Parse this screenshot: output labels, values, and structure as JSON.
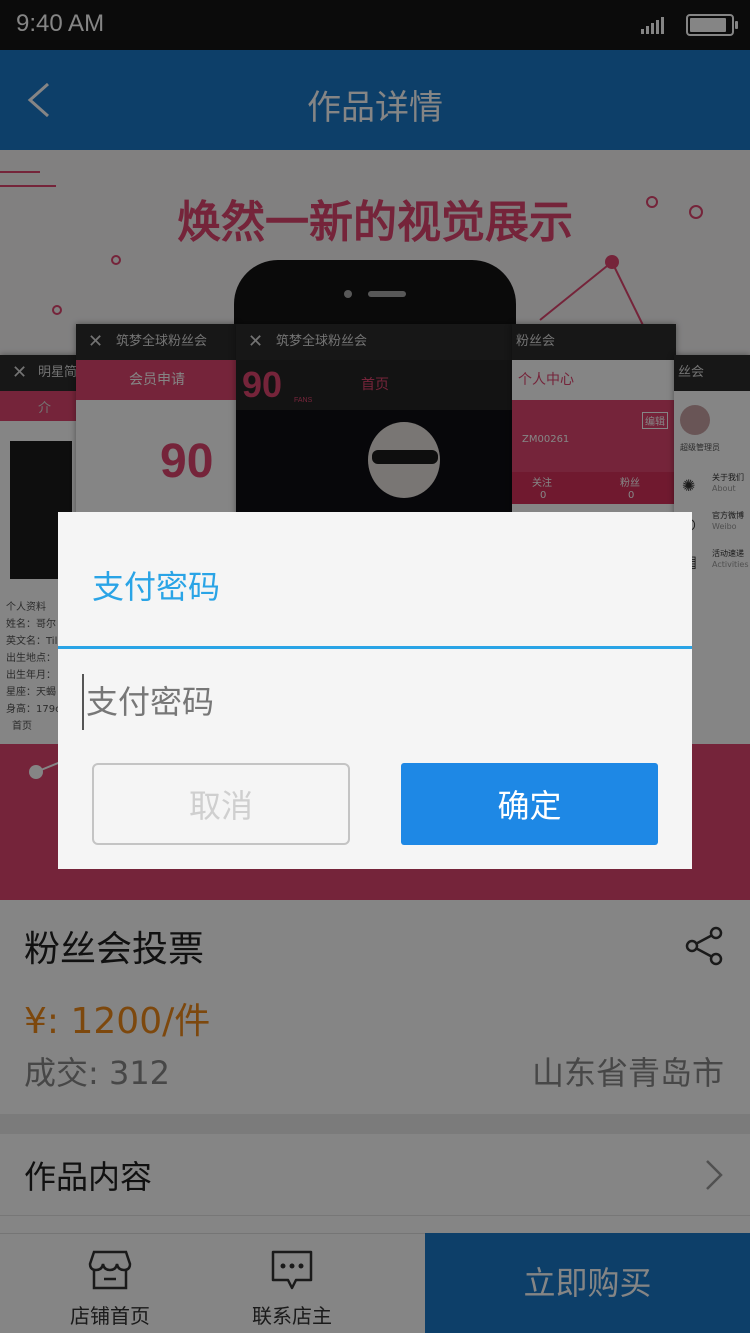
{
  "status_bar": {
    "time": "9:40 AM",
    "battery_level": 0.92
  },
  "nav": {
    "title": "作品详情"
  },
  "banner": {
    "headline": "焕然一新的视觉展示",
    "cards": [
      {
        "header": "明星简介",
        "side_lines": [
          "个人资料",
          "姓名：哥尔",
          "英文名：Tili",
          "出生地点：",
          "出生年月：",
          "星座：天蝎",
          "身高：179c",
          "首页"
        ]
      },
      {
        "header": "筑梦全球粉丝会",
        "nav": "会员申请"
      },
      {
        "header": "筑梦全球粉丝会",
        "nav": "首页",
        "logo": "90",
        "logo_sub": "FANS"
      },
      {
        "header": "粉丝会",
        "nav": "个人中心",
        "member_id": "ZM00261",
        "edit": "编辑",
        "follow": "关注",
        "fans": "粉丝",
        "follow_count": "0",
        "fans_count": "0"
      },
      {
        "header": "丝会",
        "profile_name": "超级管理员",
        "menu": [
          {
            "title": "关于我们",
            "sub": "About"
          },
          {
            "title": "官方微博",
            "sub": "Weibo"
          },
          {
            "title": "活动速递",
            "sub": "Activities"
          }
        ]
      }
    ]
  },
  "product": {
    "title": "粉丝会投票",
    "price": "¥: 1200/件",
    "deals": "成交: 312",
    "location": "山东省青岛市"
  },
  "content_row": {
    "label": "作品内容"
  },
  "tab_bar": {
    "store_home": "店铺首页",
    "contact_owner": "联系店主",
    "buy_now": "立即购买"
  },
  "dialog": {
    "title": "支付密码",
    "input_placeholder": "支付密码",
    "cancel": "取消",
    "confirm": "确定"
  },
  "colors": {
    "primary_blue": "#1a79c9",
    "accent_pink": "#e0466f",
    "dialog_accent": "#2aa4e6",
    "price_orange": "#f08a1a"
  }
}
